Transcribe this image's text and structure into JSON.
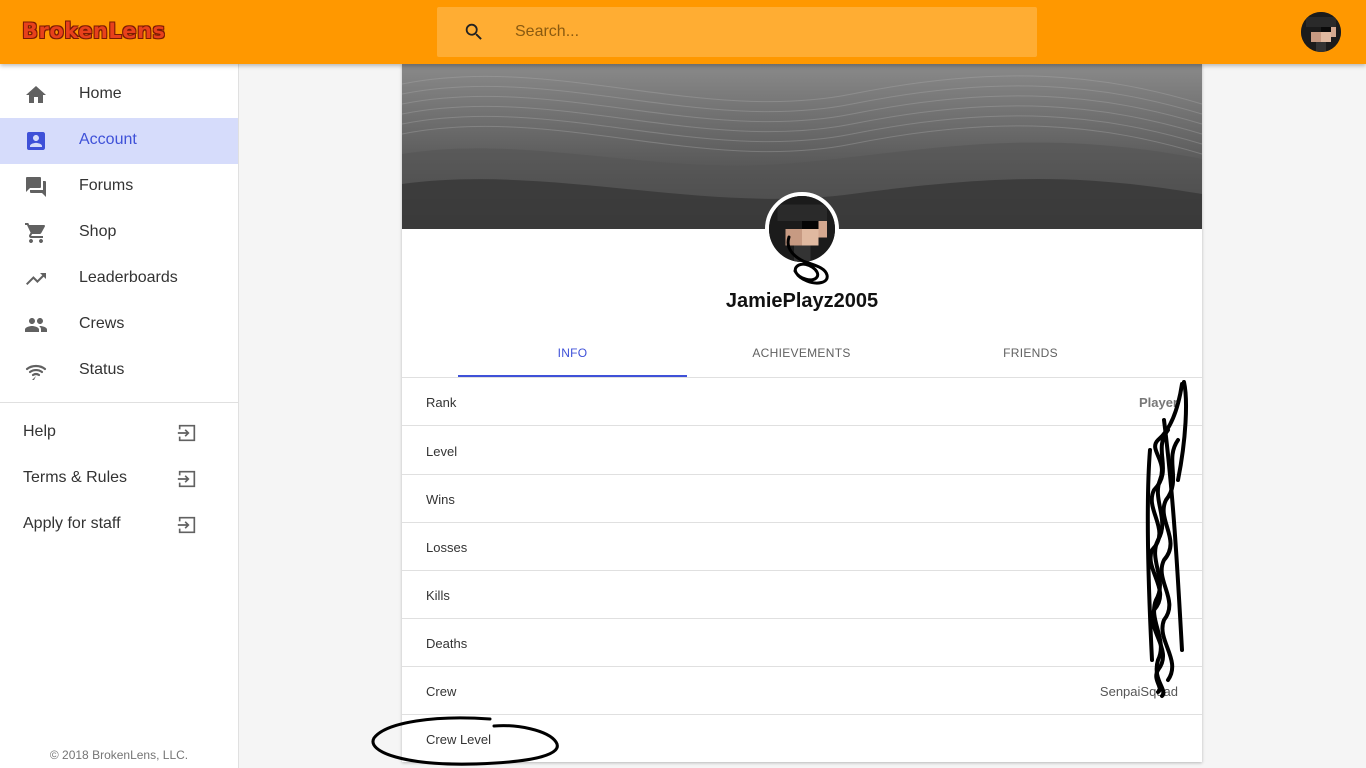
{
  "app": {
    "logo": "BrokenLens"
  },
  "search": {
    "placeholder": "Search..."
  },
  "sidebar": {
    "nav": [
      {
        "label": "Home",
        "icon": "home-icon",
        "active": false
      },
      {
        "label": "Account",
        "icon": "account-box-icon",
        "active": true
      },
      {
        "label": "Forums",
        "icon": "forum-icon",
        "active": false
      },
      {
        "label": "Shop",
        "icon": "cart-icon",
        "active": false
      },
      {
        "label": "Leaderboards",
        "icon": "trending-up-icon",
        "active": false
      },
      {
        "label": "Crews",
        "icon": "people-icon",
        "active": false
      },
      {
        "label": "Status",
        "icon": "signal-icon",
        "active": false
      }
    ],
    "links": [
      {
        "label": "Help",
        "icon": "exit-to-app-icon"
      },
      {
        "label": "Terms & Rules",
        "icon": "exit-to-app-icon"
      },
      {
        "label": "Apply for staff",
        "icon": "exit-to-app-icon"
      }
    ],
    "copyright": "© 2018 BrokenLens, LLC."
  },
  "profile": {
    "username": "JamiePlayz2005",
    "tabs": [
      {
        "label": "INFO",
        "active": true
      },
      {
        "label": "ACHIEVEMENTS",
        "active": false
      },
      {
        "label": "FRIENDS",
        "active": false
      }
    ],
    "rows": [
      {
        "label": "Rank",
        "value": "Player"
      },
      {
        "label": "Level",
        "value": ""
      },
      {
        "label": "Wins",
        "value": ""
      },
      {
        "label": "Losses",
        "value": ""
      },
      {
        "label": "Kills",
        "value": ""
      },
      {
        "label": "Deaths",
        "value": ""
      },
      {
        "label": "Crew",
        "value": "SenpaiSquad"
      },
      {
        "label": "Crew Level",
        "value": ""
      }
    ]
  },
  "colors": {
    "topbar": "#ff9800",
    "accent": "#3f51d8",
    "active_nav_bg": "#d6dcfb",
    "logo": "#e8411b"
  }
}
